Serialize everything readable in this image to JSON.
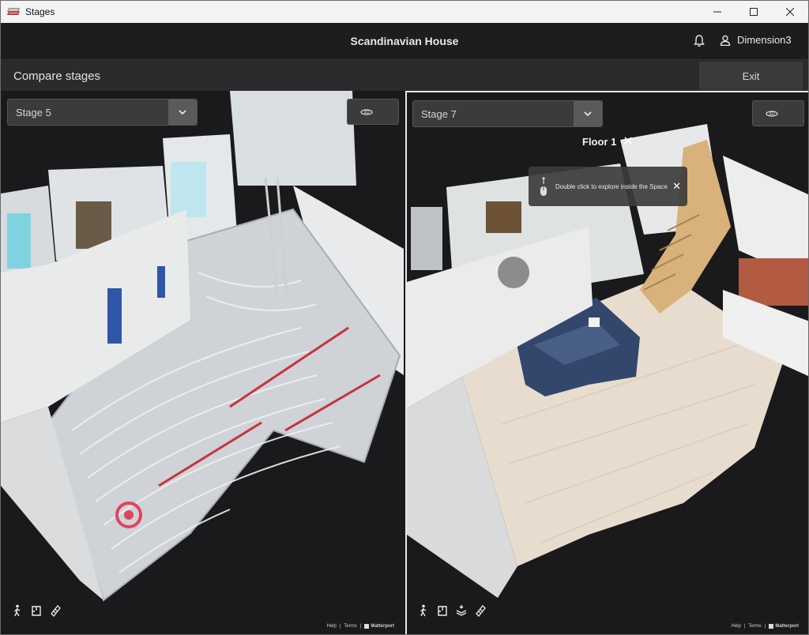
{
  "window": {
    "title": "Stages",
    "icon": "layers-icon",
    "controls": [
      "minimize-icon",
      "maximize-icon",
      "close-icon"
    ]
  },
  "header": {
    "project_title": "Scandinavian House",
    "notifications_icon": "bell-icon",
    "user_icon": "user-icon",
    "user_name": "Dimension3"
  },
  "compare": {
    "label": "Compare stages",
    "exit_label": "Exit"
  },
  "left_view": {
    "stage": "Stage 5",
    "view_icon": "3d-view-icon",
    "tools": [
      "walk-icon",
      "floorplan-icon",
      "measure-icon"
    ],
    "footer": {
      "help": "Help",
      "terms": "Terms",
      "brand": "Matterport"
    }
  },
  "right_view": {
    "stage": "Stage 7",
    "view_icon": "3d-view-icon",
    "floor_label": "Floor 1",
    "tooltip": "Double click to explore inside the Space",
    "tools": [
      "walk-icon",
      "floorplan-icon",
      "floors-icon",
      "measure-icon"
    ],
    "footer": {
      "help": "Help",
      "terms": "Terms",
      "brand": "Matterport"
    }
  },
  "colors": {
    "accent_marker": "#e0445c",
    "background": "#1b1b1d"
  }
}
